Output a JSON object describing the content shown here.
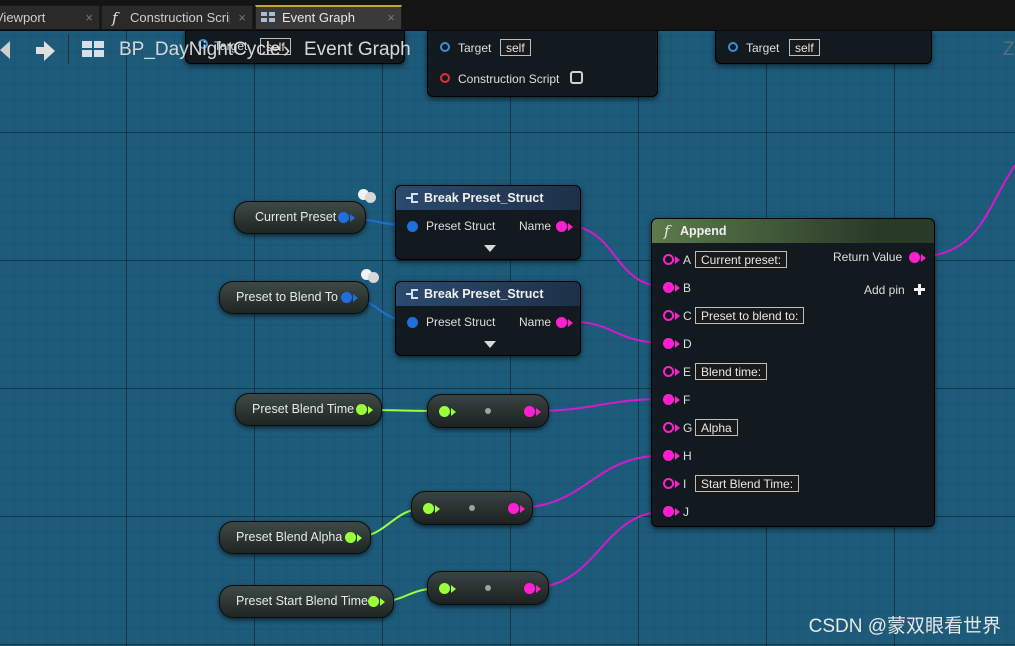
{
  "tabs": [
    {
      "label": "Viewport",
      "close": "×"
    },
    {
      "label": "Construction Script",
      "close": "×"
    },
    {
      "label": "Event Graph",
      "close": "×"
    }
  ],
  "breadcrumb": {
    "blueprint": "BP_DayNightCycle",
    "separator": "›",
    "graph": "Event Graph",
    "zoom_hint": "Z"
  },
  "top_nodes": {
    "target_label": "Target",
    "self_label": "self",
    "construction_script_label": "Construction Script"
  },
  "variables": {
    "current_preset": "Current Preset",
    "preset_to_blend_to": "Preset to Blend To",
    "preset_blend_time": "Preset Blend Time",
    "preset_blend_alpha": "Preset Blend Alpha",
    "preset_start_blend_time": "Preset Start Blend Time"
  },
  "break_nodes": {
    "title": "Break Preset_Struct",
    "input_label": "Preset Struct",
    "output_label": "Name"
  },
  "append": {
    "title": "Append",
    "return_label": "Return Value",
    "add_pin_label": "Add pin",
    "pins": [
      {
        "name": "A",
        "literal": "Current preset:"
      },
      {
        "name": "B",
        "literal": ""
      },
      {
        "name": "C",
        "literal": "Preset to blend to:"
      },
      {
        "name": "D",
        "literal": ""
      },
      {
        "name": "E",
        "literal": "Blend time:"
      },
      {
        "name": "F",
        "literal": ""
      },
      {
        "name": "G",
        "literal": "Alpha"
      },
      {
        "name": "H",
        "literal": ""
      },
      {
        "name": "I",
        "literal": "Start Blend Time:"
      },
      {
        "name": "J",
        "literal": ""
      }
    ]
  },
  "colors": {
    "struct_pin": "#1f6fdc",
    "string_pin": "#ff1ed0",
    "float_pin": "#9bff3a",
    "exec_pin": "#e03030",
    "header_struct": "#2c4a6e",
    "header_function": "#5c7a4c",
    "grid_bg": "#1d5b7a"
  },
  "watermark": "CSDN @蒙双眼看世界"
}
